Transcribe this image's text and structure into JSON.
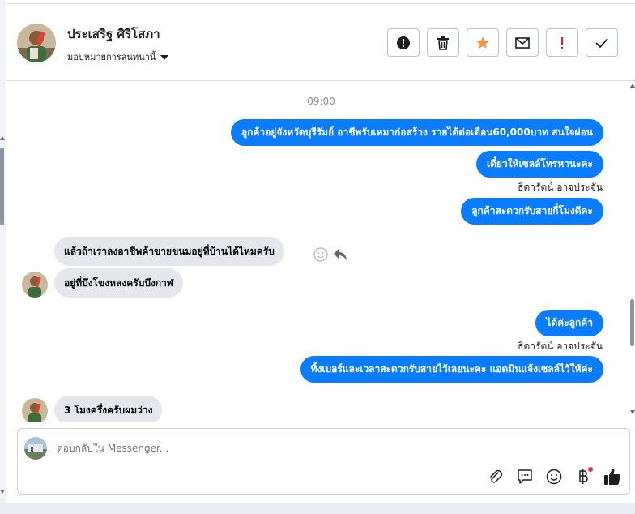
{
  "header": {
    "name": "ประเสริฐ ศิริโสภา",
    "assign_label": "มอบหมายการสนทนานี้",
    "toolbar": [
      {
        "name": "mark-spam-button",
        "icon": "alert-circle-icon"
      },
      {
        "name": "delete-button",
        "icon": "trash-icon"
      },
      {
        "name": "star-button",
        "icon": "star-icon"
      },
      {
        "name": "mark-unread-button",
        "icon": "envelope-icon"
      },
      {
        "name": "follow-up-button",
        "icon": "exclamation-icon"
      },
      {
        "name": "mark-done-button",
        "icon": "check-icon"
      }
    ]
  },
  "messages": {
    "time": "09:00",
    "out1": "ลูกค้าอยู่จังหวัดบุรีรัมย์ อาชีพรับเหมาก่อสร้าง รายได้ต่อเดือน60,000บาท สนใจผ่อน",
    "out2": "เดี๋ยวให้เซลล์โทรหานะคะ",
    "sender1": "ธิดารัตน์ อาจประจัน",
    "out3": "ลูกค้าสะดวกรับสายกี่โมงดีคะ",
    "in1": "แล้วถ้าเราลงอาชีพค้าขายขนมอยู่ที่บ้านได้ไหมครับ",
    "in2": "อยู่ที่บึงโขงหลงครับบึงกาฬ",
    "out4": "ได้ค่ะลูกค้า",
    "sender2": "ธิดารัตน์ อาจประจัน",
    "out5": "ทิ้งเบอร์และเวลาสะดวกรับสายไว้เลยนะคะ แอดมินแจ้งเซลล์ไว้ให้ค่ะ",
    "in3": "3 โมงครึ่งครับผมว่าง"
  },
  "composer": {
    "placeholder": "ตอบกลับใน Messenger..."
  },
  "colors": {
    "outgoing_bubble": "#0a7cff",
    "incoming_bubble": "#e4e6eb",
    "star": "#f7923a",
    "alert_red": "#e41e3f",
    "like": "#1c1e21"
  }
}
